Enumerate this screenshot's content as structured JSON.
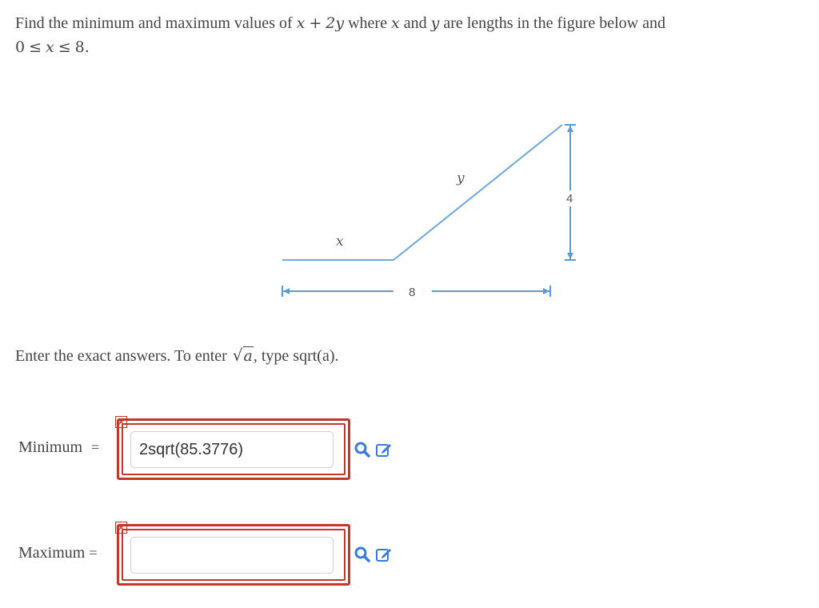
{
  "problem": {
    "text_find": "Find the minimum and maximum values of",
    "expr_x": "x",
    "expr_plus": "+",
    "expr_2y": "2y",
    "text_where": "where",
    "var_x": "x",
    "text_and": "and",
    "var_y": "y",
    "text_rest": "are lengths in the figure below and",
    "ineq_zero": "0",
    "ineq_le1": "≤",
    "ineq_x": "x",
    "ineq_le2": "≤",
    "ineq_eight": "8."
  },
  "figure": {
    "label_x": "x",
    "label_y": "y",
    "label_height": "4",
    "label_width": "8",
    "line_color": "#6fa8dc",
    "dim_color": "#5b9bd5"
  },
  "instructions": {
    "text_before": "Enter the exact answers. To enter",
    "sqrt_symbol": "√",
    "sqrt_arg": "a",
    "text_after": ", type sqrt(a)."
  },
  "minimum": {
    "label": "Minimum",
    "equals": "=",
    "value": "2sqrt(85.3776)",
    "error_mark": "×",
    "status": "incorrect"
  },
  "maximum": {
    "label": "Maximum",
    "equals": "=",
    "value": "",
    "error_mark": "×",
    "status": "incorrect"
  },
  "icons": {
    "preview": "magnifier-icon",
    "edit": "pencil-edit-icon",
    "accent": "#3a7bd5",
    "error": "#c0392b"
  }
}
